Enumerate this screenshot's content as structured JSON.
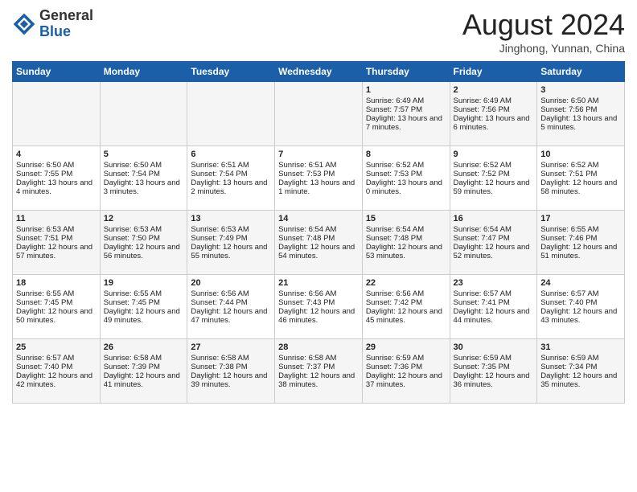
{
  "header": {
    "logo_general": "General",
    "logo_blue": "Blue",
    "month_title": "August 2024",
    "location": "Jinghong, Yunnan, China"
  },
  "weekdays": [
    "Sunday",
    "Monday",
    "Tuesday",
    "Wednesday",
    "Thursday",
    "Friday",
    "Saturday"
  ],
  "weeks": [
    [
      {
        "day": "",
        "content": ""
      },
      {
        "day": "",
        "content": ""
      },
      {
        "day": "",
        "content": ""
      },
      {
        "day": "",
        "content": ""
      },
      {
        "day": "1",
        "content": "Sunrise: 6:49 AM\nSunset: 7:57 PM\nDaylight: 13 hours and 7 minutes."
      },
      {
        "day": "2",
        "content": "Sunrise: 6:49 AM\nSunset: 7:56 PM\nDaylight: 13 hours and 6 minutes."
      },
      {
        "day": "3",
        "content": "Sunrise: 6:50 AM\nSunset: 7:56 PM\nDaylight: 13 hours and 5 minutes."
      }
    ],
    [
      {
        "day": "4",
        "content": "Sunrise: 6:50 AM\nSunset: 7:55 PM\nDaylight: 13 hours and 4 minutes."
      },
      {
        "day": "5",
        "content": "Sunrise: 6:50 AM\nSunset: 7:54 PM\nDaylight: 13 hours and 3 minutes."
      },
      {
        "day": "6",
        "content": "Sunrise: 6:51 AM\nSunset: 7:54 PM\nDaylight: 13 hours and 2 minutes."
      },
      {
        "day": "7",
        "content": "Sunrise: 6:51 AM\nSunset: 7:53 PM\nDaylight: 13 hours and 1 minute."
      },
      {
        "day": "8",
        "content": "Sunrise: 6:52 AM\nSunset: 7:53 PM\nDaylight: 13 hours and 0 minutes."
      },
      {
        "day": "9",
        "content": "Sunrise: 6:52 AM\nSunset: 7:52 PM\nDaylight: 12 hours and 59 minutes."
      },
      {
        "day": "10",
        "content": "Sunrise: 6:52 AM\nSunset: 7:51 PM\nDaylight: 12 hours and 58 minutes."
      }
    ],
    [
      {
        "day": "11",
        "content": "Sunrise: 6:53 AM\nSunset: 7:51 PM\nDaylight: 12 hours and 57 minutes."
      },
      {
        "day": "12",
        "content": "Sunrise: 6:53 AM\nSunset: 7:50 PM\nDaylight: 12 hours and 56 minutes."
      },
      {
        "day": "13",
        "content": "Sunrise: 6:53 AM\nSunset: 7:49 PM\nDaylight: 12 hours and 55 minutes."
      },
      {
        "day": "14",
        "content": "Sunrise: 6:54 AM\nSunset: 7:48 PM\nDaylight: 12 hours and 54 minutes."
      },
      {
        "day": "15",
        "content": "Sunrise: 6:54 AM\nSunset: 7:48 PM\nDaylight: 12 hours and 53 minutes."
      },
      {
        "day": "16",
        "content": "Sunrise: 6:54 AM\nSunset: 7:47 PM\nDaylight: 12 hours and 52 minutes."
      },
      {
        "day": "17",
        "content": "Sunrise: 6:55 AM\nSunset: 7:46 PM\nDaylight: 12 hours and 51 minutes."
      }
    ],
    [
      {
        "day": "18",
        "content": "Sunrise: 6:55 AM\nSunset: 7:45 PM\nDaylight: 12 hours and 50 minutes."
      },
      {
        "day": "19",
        "content": "Sunrise: 6:55 AM\nSunset: 7:45 PM\nDaylight: 12 hours and 49 minutes."
      },
      {
        "day": "20",
        "content": "Sunrise: 6:56 AM\nSunset: 7:44 PM\nDaylight: 12 hours and 47 minutes."
      },
      {
        "day": "21",
        "content": "Sunrise: 6:56 AM\nSunset: 7:43 PM\nDaylight: 12 hours and 46 minutes."
      },
      {
        "day": "22",
        "content": "Sunrise: 6:56 AM\nSunset: 7:42 PM\nDaylight: 12 hours and 45 minutes."
      },
      {
        "day": "23",
        "content": "Sunrise: 6:57 AM\nSunset: 7:41 PM\nDaylight: 12 hours and 44 minutes."
      },
      {
        "day": "24",
        "content": "Sunrise: 6:57 AM\nSunset: 7:40 PM\nDaylight: 12 hours and 43 minutes."
      }
    ],
    [
      {
        "day": "25",
        "content": "Sunrise: 6:57 AM\nSunset: 7:40 PM\nDaylight: 12 hours and 42 minutes."
      },
      {
        "day": "26",
        "content": "Sunrise: 6:58 AM\nSunset: 7:39 PM\nDaylight: 12 hours and 41 minutes."
      },
      {
        "day": "27",
        "content": "Sunrise: 6:58 AM\nSunset: 7:38 PM\nDaylight: 12 hours and 39 minutes."
      },
      {
        "day": "28",
        "content": "Sunrise: 6:58 AM\nSunset: 7:37 PM\nDaylight: 12 hours and 38 minutes."
      },
      {
        "day": "29",
        "content": "Sunrise: 6:59 AM\nSunset: 7:36 PM\nDaylight: 12 hours and 37 minutes."
      },
      {
        "day": "30",
        "content": "Sunrise: 6:59 AM\nSunset: 7:35 PM\nDaylight: 12 hours and 36 minutes."
      },
      {
        "day": "31",
        "content": "Sunrise: 6:59 AM\nSunset: 7:34 PM\nDaylight: 12 hours and 35 minutes."
      }
    ]
  ]
}
